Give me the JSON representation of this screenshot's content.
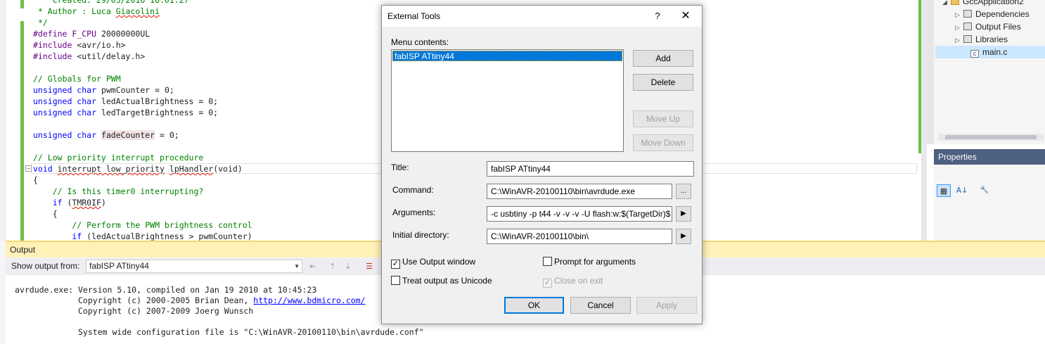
{
  "editor": {
    "lines": [
      [
        {
          "t": "    Created: 29/05/2016 18.01.27",
          "c": "cm"
        }
      ],
      [
        {
          "t": " * Author : Luca ",
          "c": "cm"
        },
        {
          "t": "Giacolini",
          "c": "cm squig"
        }
      ],
      [
        {
          "t": " */",
          "c": "cm"
        }
      ],
      [
        {
          "t": "#define ",
          "c": "pp"
        },
        {
          "t": "F_CPU",
          "c": "mac"
        },
        {
          "t": " 20000000UL",
          "c": "var"
        }
      ],
      [
        {
          "t": "#include ",
          "c": "pp"
        },
        {
          "t": "<avr/io.h>",
          "c": "var"
        }
      ],
      [
        {
          "t": "#include ",
          "c": "pp"
        },
        {
          "t": "<util/delay.h>",
          "c": "var"
        }
      ],
      [
        {
          "t": "",
          "c": "var"
        }
      ],
      [
        {
          "t": "// Globals for PWM",
          "c": "cm"
        }
      ],
      [
        {
          "t": "unsigned char ",
          "c": "kw"
        },
        {
          "t": "pwmCounter = 0;",
          "c": "var"
        }
      ],
      [
        {
          "t": "unsigned char ",
          "c": "kw"
        },
        {
          "t": "ledActualBrightness = 0;",
          "c": "var"
        }
      ],
      [
        {
          "t": "unsigned char ",
          "c": "kw"
        },
        {
          "t": "ledTargetBrightness = 0;",
          "c": "var"
        }
      ],
      [
        {
          "t": "",
          "c": "var"
        }
      ],
      [
        {
          "t": "unsigned char ",
          "c": "kw"
        },
        {
          "t": "fadeCounter",
          "c": "var hilite"
        },
        {
          "t": " = 0;",
          "c": "var"
        }
      ],
      [
        {
          "t": "",
          "c": "var"
        }
      ],
      [
        {
          "t": "// Low priority interrupt procedure",
          "c": "cm"
        }
      ],
      [
        {
          "t": "void ",
          "c": "kw"
        },
        {
          "t": "interrupt low_priority",
          "c": "var squig"
        },
        {
          "t": " ",
          "c": "var"
        },
        {
          "t": "lpHandler",
          "c": "var squig"
        },
        {
          "t": "(void)",
          "c": "var"
        }
      ],
      [
        {
          "t": "{",
          "c": "var"
        }
      ],
      [
        {
          "t": "    // Is this timer0 interrupting?",
          "c": "cm"
        }
      ],
      [
        {
          "t": "    if ",
          "c": "kw"
        },
        {
          "t": "(",
          "c": "var"
        },
        {
          "t": "TMR0IF",
          "c": "var squig"
        },
        {
          "t": ")",
          "c": "var"
        }
      ],
      [
        {
          "t": "    {",
          "c": "var"
        }
      ],
      [
        {
          "t": "        // Perform the PWM brightness control",
          "c": "cm"
        }
      ],
      [
        {
          "t": "        if ",
          "c": "kw"
        },
        {
          "t": "(ledActualBrightness > pwmCounter)",
          "c": "var"
        }
      ]
    ],
    "collapse_glyph": "−"
  },
  "solution": {
    "items": [
      {
        "label": "GccApplication2",
        "tri": "◢"
      },
      {
        "label": "Dependencies",
        "tri": "▷"
      },
      {
        "label": "Output Files",
        "tri": "▷"
      },
      {
        "label": "Libraries",
        "tri": "▷"
      },
      {
        "label": "main.c",
        "tri": ""
      }
    ],
    "c_icon_letter": "c"
  },
  "properties": {
    "title": "Properties",
    "btn_categorized": "▦",
    "btn_alpha": "A↓",
    "btn_pages": "🔧"
  },
  "output": {
    "title": "Output",
    "show_from_label": "Show output from:",
    "show_from_value": "fabISP ATtiny44",
    "line1": "avrdude.exe: Version 5.10, compiled on Jan 19 2010 at 10:45:23",
    "line2_prefix": "             Copyright (c) 2000-2005 Brian Dean, ",
    "line2_link": "http://www.bdmicro.com/",
    "line3": "             Copyright (c) 2007-2009 Joerg Wunsch",
    "line4": "",
    "line5": "             System wide configuration file is \"C:\\WinAVR-20100110\\bin\\avrdude.conf\""
  },
  "dialog": {
    "title": "External Tools",
    "help": "?",
    "close": "✕",
    "menu_contents_label": "Menu contents:",
    "menu_items": [
      "fabISP ATtiny44"
    ],
    "add": "Add",
    "delete": "Delete",
    "move_up": "Move Up",
    "move_down": "Move Down",
    "title_label": "Title:",
    "title_value": "fabISP ATtiny44",
    "command_label": "Command:",
    "command_value": "C:\\WinAVR-20100110\\bin\\avrdude.exe",
    "command_browse": "...",
    "arguments_label": "Arguments:",
    "arguments_value": "-c usbtiny -p t44 -v -v -v -U flash:w:$(TargetDir)$",
    "initial_dir_label": "Initial directory:",
    "initial_dir_value": "C:\\WinAVR-20100110\\bin\\",
    "arrow": "▶",
    "use_output_window": "Use Output window",
    "treat_unicode": "Treat output as Unicode",
    "prompt_args": "Prompt for arguments",
    "close_on_exit": "Close on exit",
    "ok": "OK",
    "cancel": "Cancel",
    "apply": "Apply",
    "check": "✓"
  }
}
